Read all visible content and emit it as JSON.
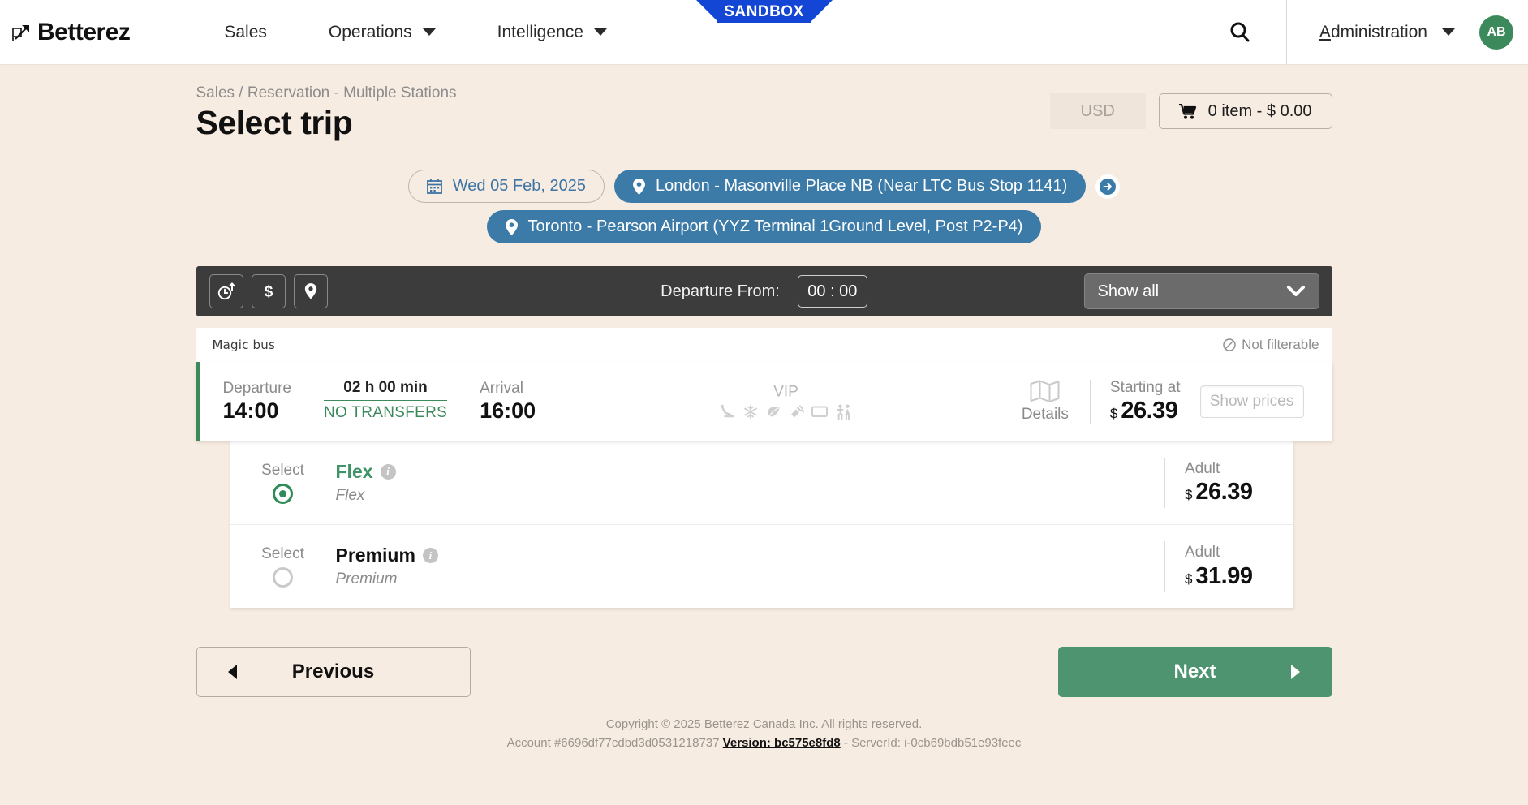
{
  "sandbox": {
    "label": "SANDBOX",
    "color": "#1346d4"
  },
  "topnav": {
    "brand": "Betterez",
    "links": [
      {
        "label": "Sales",
        "has_caret": false
      },
      {
        "label": "Operations",
        "has_caret": true
      },
      {
        "label": "Intelligence",
        "has_caret": true
      }
    ],
    "search_icon": "search-icon",
    "account_menu": {
      "accesskey": "A",
      "rest": "dministration"
    },
    "avatar_initials": "AB"
  },
  "header": {
    "breadcrumb": "Sales / Reservation - Multiple Stations",
    "title": "Select trip",
    "currency": "USD",
    "cart_label": "0 item - $ 0.00"
  },
  "search_pills": {
    "date": "Wed 05 Feb, 2025",
    "origin": "London - Masonville Place NB (Near LTC Bus Stop 1141)",
    "destination": "Toronto - Pearson Airport (YYZ Terminal 1Ground Level, Post P2-P4)",
    "swap_icon": "arrow-right-icon"
  },
  "toolbar": {
    "sort_buttons": [
      {
        "name": "sort-by-time",
        "icon": "clock-arrow-up-icon"
      },
      {
        "name": "sort-by-price",
        "icon": "dollar-icon"
      },
      {
        "name": "sort-by-station",
        "icon": "map-pin-icon"
      }
    ],
    "departure_from_label": "Departure From:",
    "departure_time_value": "00 : 00",
    "filter_select_value": "Show all"
  },
  "trip": {
    "carrier": "Magic bus",
    "not_filterable": "Not filterable",
    "departure_label": "Departure",
    "departure_time": "14:00",
    "duration": "02 h 00 min",
    "transfers": "NO TRANSFERS",
    "arrival_label": "Arrival",
    "arrival_time": "16:00",
    "vip_label": "VIP",
    "amenities": [
      "reclining-seat-icon",
      "snowflake-icon",
      "leaf-icon",
      "power-plug-icon",
      "tv-monitor-icon",
      "restroom-icon"
    ],
    "details_label": "Details",
    "details_icon": "map-icon",
    "starting_at_label": "Starting at",
    "starting_at_currency": "$",
    "starting_at_amount": "26.39",
    "show_prices_label": "Show prices"
  },
  "fares": {
    "select_label": "Select",
    "price_label": "Adult",
    "currency": "$",
    "rows": [
      {
        "name": "Flex",
        "description": "Flex",
        "amount": "26.39",
        "selected": true
      },
      {
        "name": "Premium",
        "description": "Premium",
        "amount": "31.99",
        "selected": false
      }
    ]
  },
  "actions": {
    "previous": "Previous",
    "next": "Next"
  },
  "footer": {
    "copyright": "Copyright © 2025 Betterez Canada Inc. All rights reserved.",
    "account": "Account #6696df77cdbd3d0531218737",
    "version": "Version: bc575e8fd8",
    "server": "- ServerId: i-0cb69bdb51e93feec"
  },
  "colors": {
    "page_bg": "#f7ece1",
    "accent_green": "#3c8a5c",
    "next_green": "#4e9470",
    "pill_blue": "#3c7ba8",
    "toolbar_dark": "#3c3c3c"
  }
}
